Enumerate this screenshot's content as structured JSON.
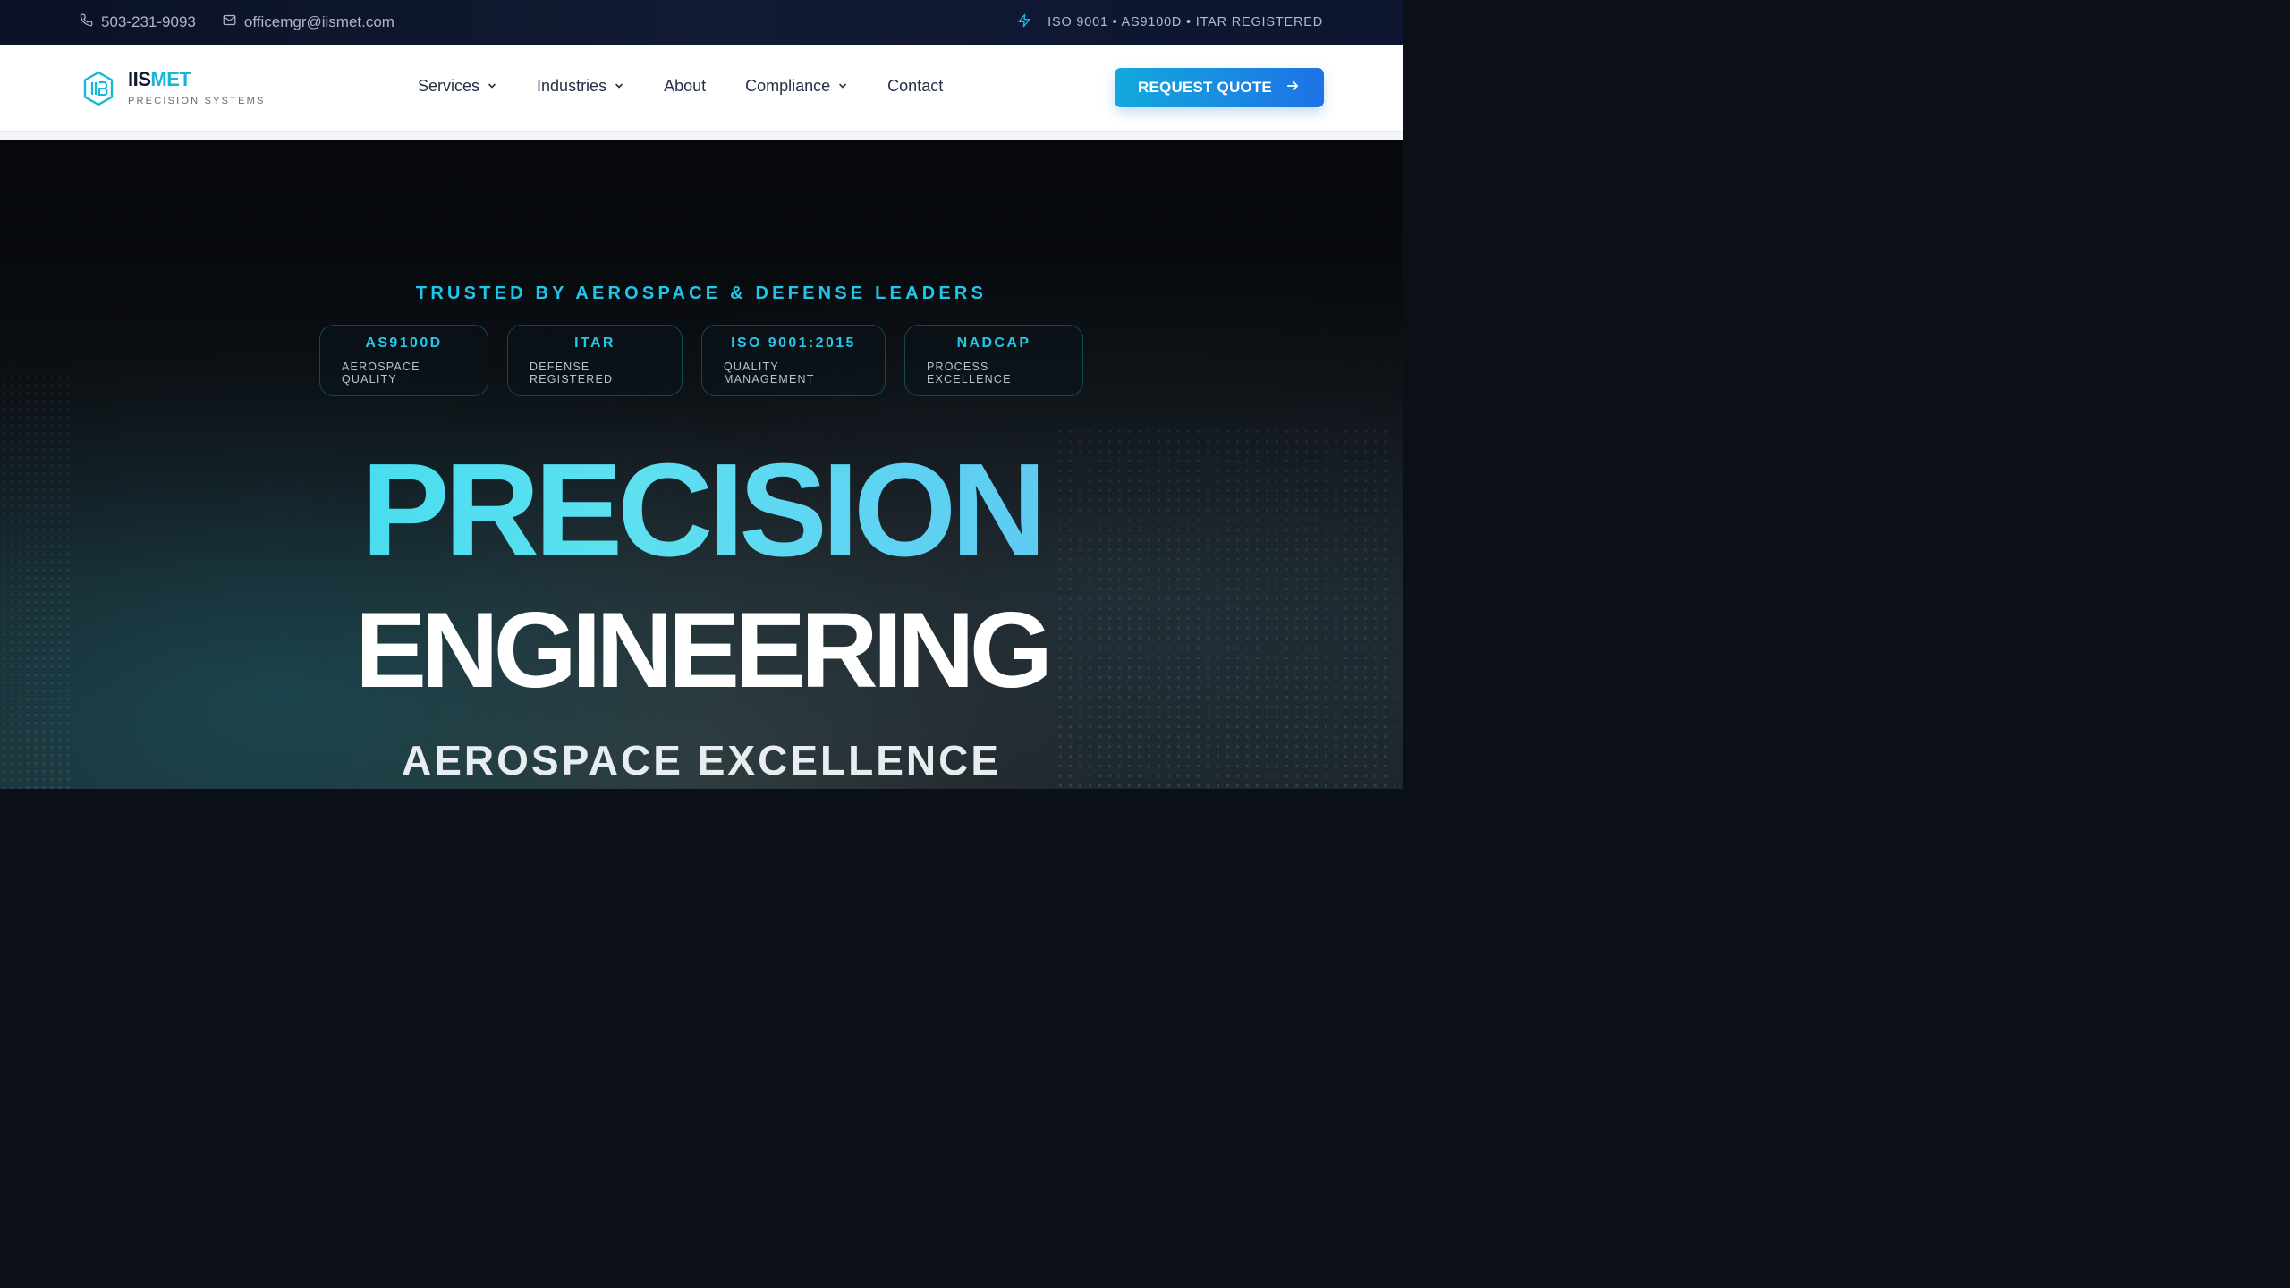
{
  "topbar": {
    "phone": "503-231-9093",
    "email": "officemgr@iismet.com",
    "certifications": "ISO 9001 • AS9100D • ITAR REGISTERED"
  },
  "brand": {
    "name_part1": "IIS",
    "name_part2": "MET",
    "subtitle": "PRECISION SYSTEMS",
    "accent_color": "#16b6d9"
  },
  "nav": {
    "items": [
      {
        "label": "Services",
        "dropdown": true
      },
      {
        "label": "Industries",
        "dropdown": true
      },
      {
        "label": "About",
        "dropdown": false
      },
      {
        "label": "Compliance",
        "dropdown": true
      },
      {
        "label": "Contact",
        "dropdown": false
      }
    ],
    "cta_label": "REQUEST QUOTE"
  },
  "hero": {
    "tagline": "TRUSTED BY AEROSPACE & DEFENSE LEADERS",
    "badges": [
      {
        "title": "AS9100D",
        "desc": "AEROSPACE QUALITY"
      },
      {
        "title": "ITAR",
        "desc": "DEFENSE REGISTERED"
      },
      {
        "title": "ISO 9001:2015",
        "desc": "QUALITY MANAGEMENT"
      },
      {
        "title": "NADCAP",
        "desc": "PROCESS EXCELLENCE"
      }
    ],
    "headline_line1": "PRECISION",
    "headline_line2": "ENGINEERING",
    "subheadline": "AEROSPACE EXCELLENCE"
  },
  "colors": {
    "cta_gradient_start": "#13a9dc",
    "cta_gradient_end": "#1e72e6",
    "hero_accent": "#22c6e8"
  }
}
